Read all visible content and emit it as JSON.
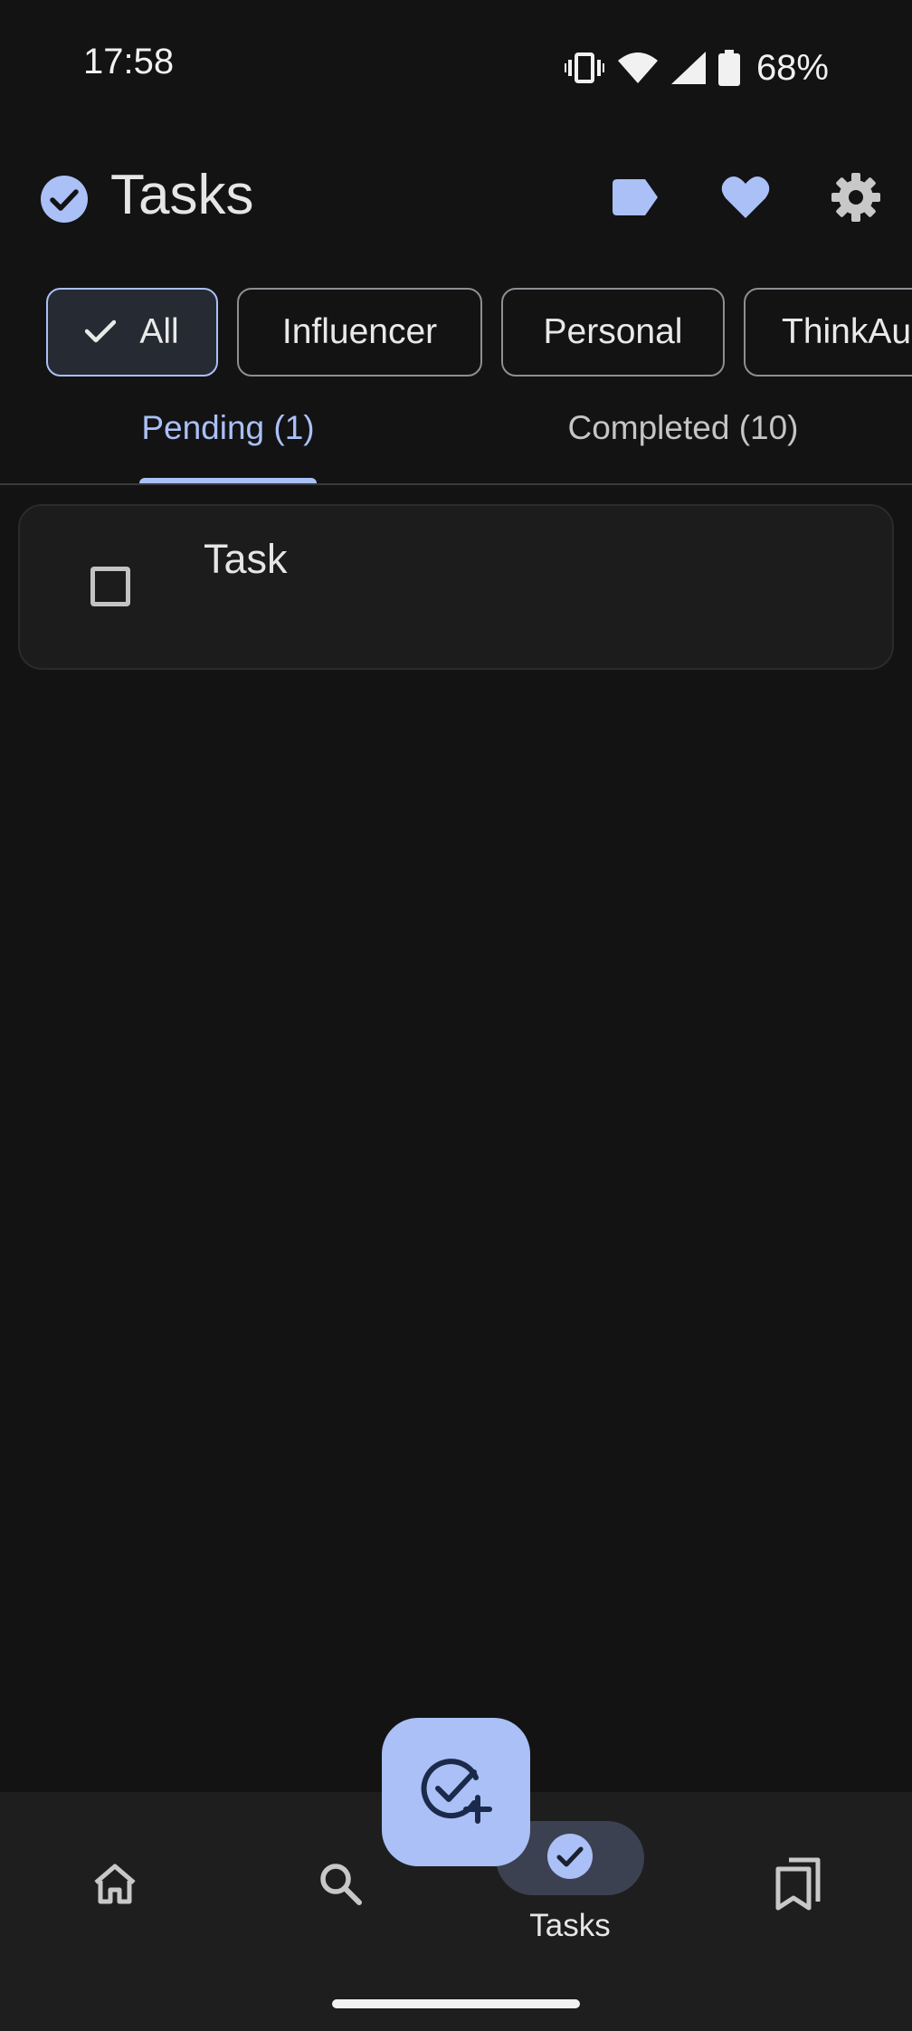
{
  "status_bar": {
    "time": "17:58",
    "battery": "68%"
  },
  "app_bar": {
    "title": "Tasks"
  },
  "filters": {
    "chips": [
      "All",
      "Influencer",
      "Personal",
      "ThinkAu"
    ],
    "selected": "All"
  },
  "tabs": {
    "pending": "Pending (1)",
    "completed": "Completed (10)"
  },
  "tasks": [
    {
      "title": "Task",
      "completed": false
    }
  ],
  "bottom_nav": {
    "active_label": "Tasks"
  },
  "colors": {
    "accent": "#aac0f6",
    "background": "#131314",
    "surface": "#1c1c1d"
  }
}
